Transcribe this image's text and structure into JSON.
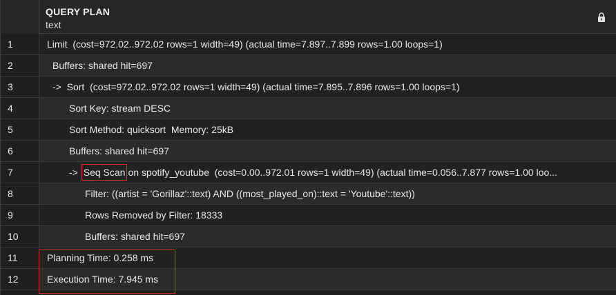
{
  "header": {
    "column_name": "QUERY PLAN",
    "column_type": "text",
    "lock_icon": "lock-icon"
  },
  "rows": [
    {
      "num": "1",
      "indent": 11,
      "text": "Limit  (cost=972.02..972.02 rows=1 width=49) (actual time=7.897..7.899 rows=1.00 loops=1)"
    },
    {
      "num": "2",
      "indent": 19,
      "text": "Buffers: shared hit=697"
    },
    {
      "num": "3",
      "indent": 19,
      "text": "->  Sort  (cost=972.02..972.02 rows=1 width=49) (actual time=7.895..7.896 rows=1.00 loops=1)"
    },
    {
      "num": "4",
      "indent": 43,
      "text": "Sort Key: stream DESC"
    },
    {
      "num": "5",
      "indent": 43,
      "text": "Sort Method: quicksort  Memory: 25kB"
    },
    {
      "num": "6",
      "indent": 43,
      "text": "Buffers: shared hit=697"
    },
    {
      "num": "7",
      "indent": 43,
      "prefix": "-> ",
      "highlight": "Seq Scan",
      "text": "on spotify_youtube  (cost=0.00..972.01 rows=1 width=49) (actual time=0.056..7.877 rows=1.00 loo..."
    },
    {
      "num": "8",
      "indent": 66,
      "text": "Filter: ((artist = 'Gorillaz'::text) AND ((most_played_on)::text = 'Youtube'::text))"
    },
    {
      "num": "9",
      "indent": 66,
      "text": "Rows Removed by Filter: 18333"
    },
    {
      "num": "10",
      "indent": 66,
      "text": "Buffers: shared hit=697"
    },
    {
      "num": "11",
      "indent": 11,
      "text": "Planning Time: 0.258 ms"
    },
    {
      "num": "12",
      "indent": 11,
      "text": "Execution Time: 7.945 ms"
    }
  ],
  "colors": {
    "highlight_border": "#e03030",
    "background": "#1e1e1e"
  }
}
